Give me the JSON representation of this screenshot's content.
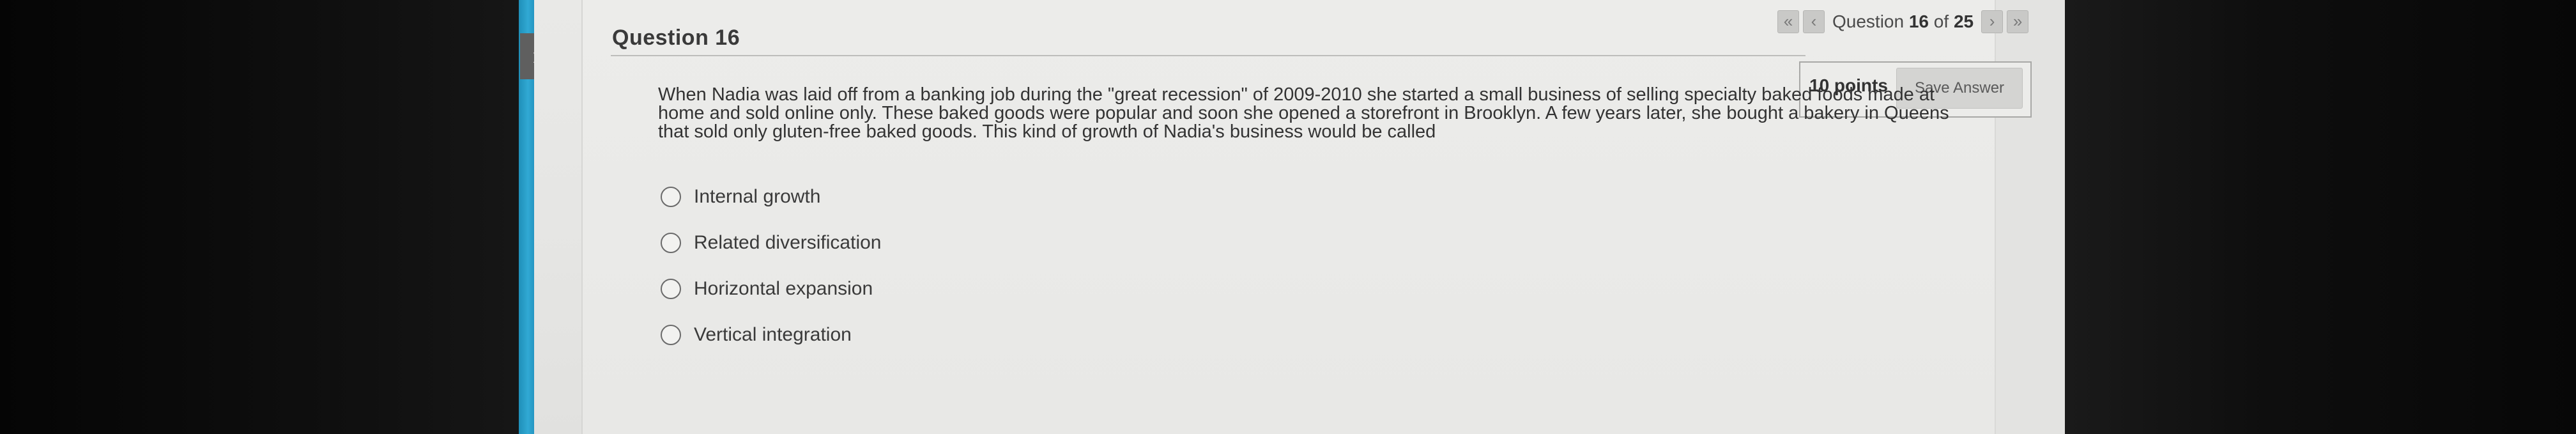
{
  "sidebar": {
    "toggle_glyph": "›"
  },
  "question": {
    "title": "Question 16",
    "points": "10 points",
    "save_label": "Save Answer",
    "text": "When Nadia was laid off from a banking job during the \"great recession\" of 2009-2010 she started a small business of selling specialty baked foods made at home and sold online only. These baked goods were popular and soon she opened a storefront in Brooklyn. A few years later, she bought a bakery in Queens that sold only gluten-free baked goods. This kind of growth of Nadia's business would be called",
    "options": [
      {
        "label": "Internal growth"
      },
      {
        "label": "Related diversification"
      },
      {
        "label": "Horizontal expansion"
      },
      {
        "label": "Vertical integration"
      }
    ]
  },
  "navigation": {
    "first_glyph": "«",
    "prev_glyph": "‹",
    "next_glyph": "›",
    "last_glyph": "»",
    "prefix": "Question",
    "current": "16",
    "of_word": "of",
    "total": "25"
  },
  "icons": {
    "first": "double-chevron-left-icon",
    "prev": "chevron-left-icon",
    "next": "chevron-right-icon",
    "last": "double-chevron-right-icon",
    "sidebar_toggle": "chevron-right-icon"
  },
  "colors": {
    "accent_strip": "#31a9d4",
    "page_background": "#e9e9e7"
  }
}
